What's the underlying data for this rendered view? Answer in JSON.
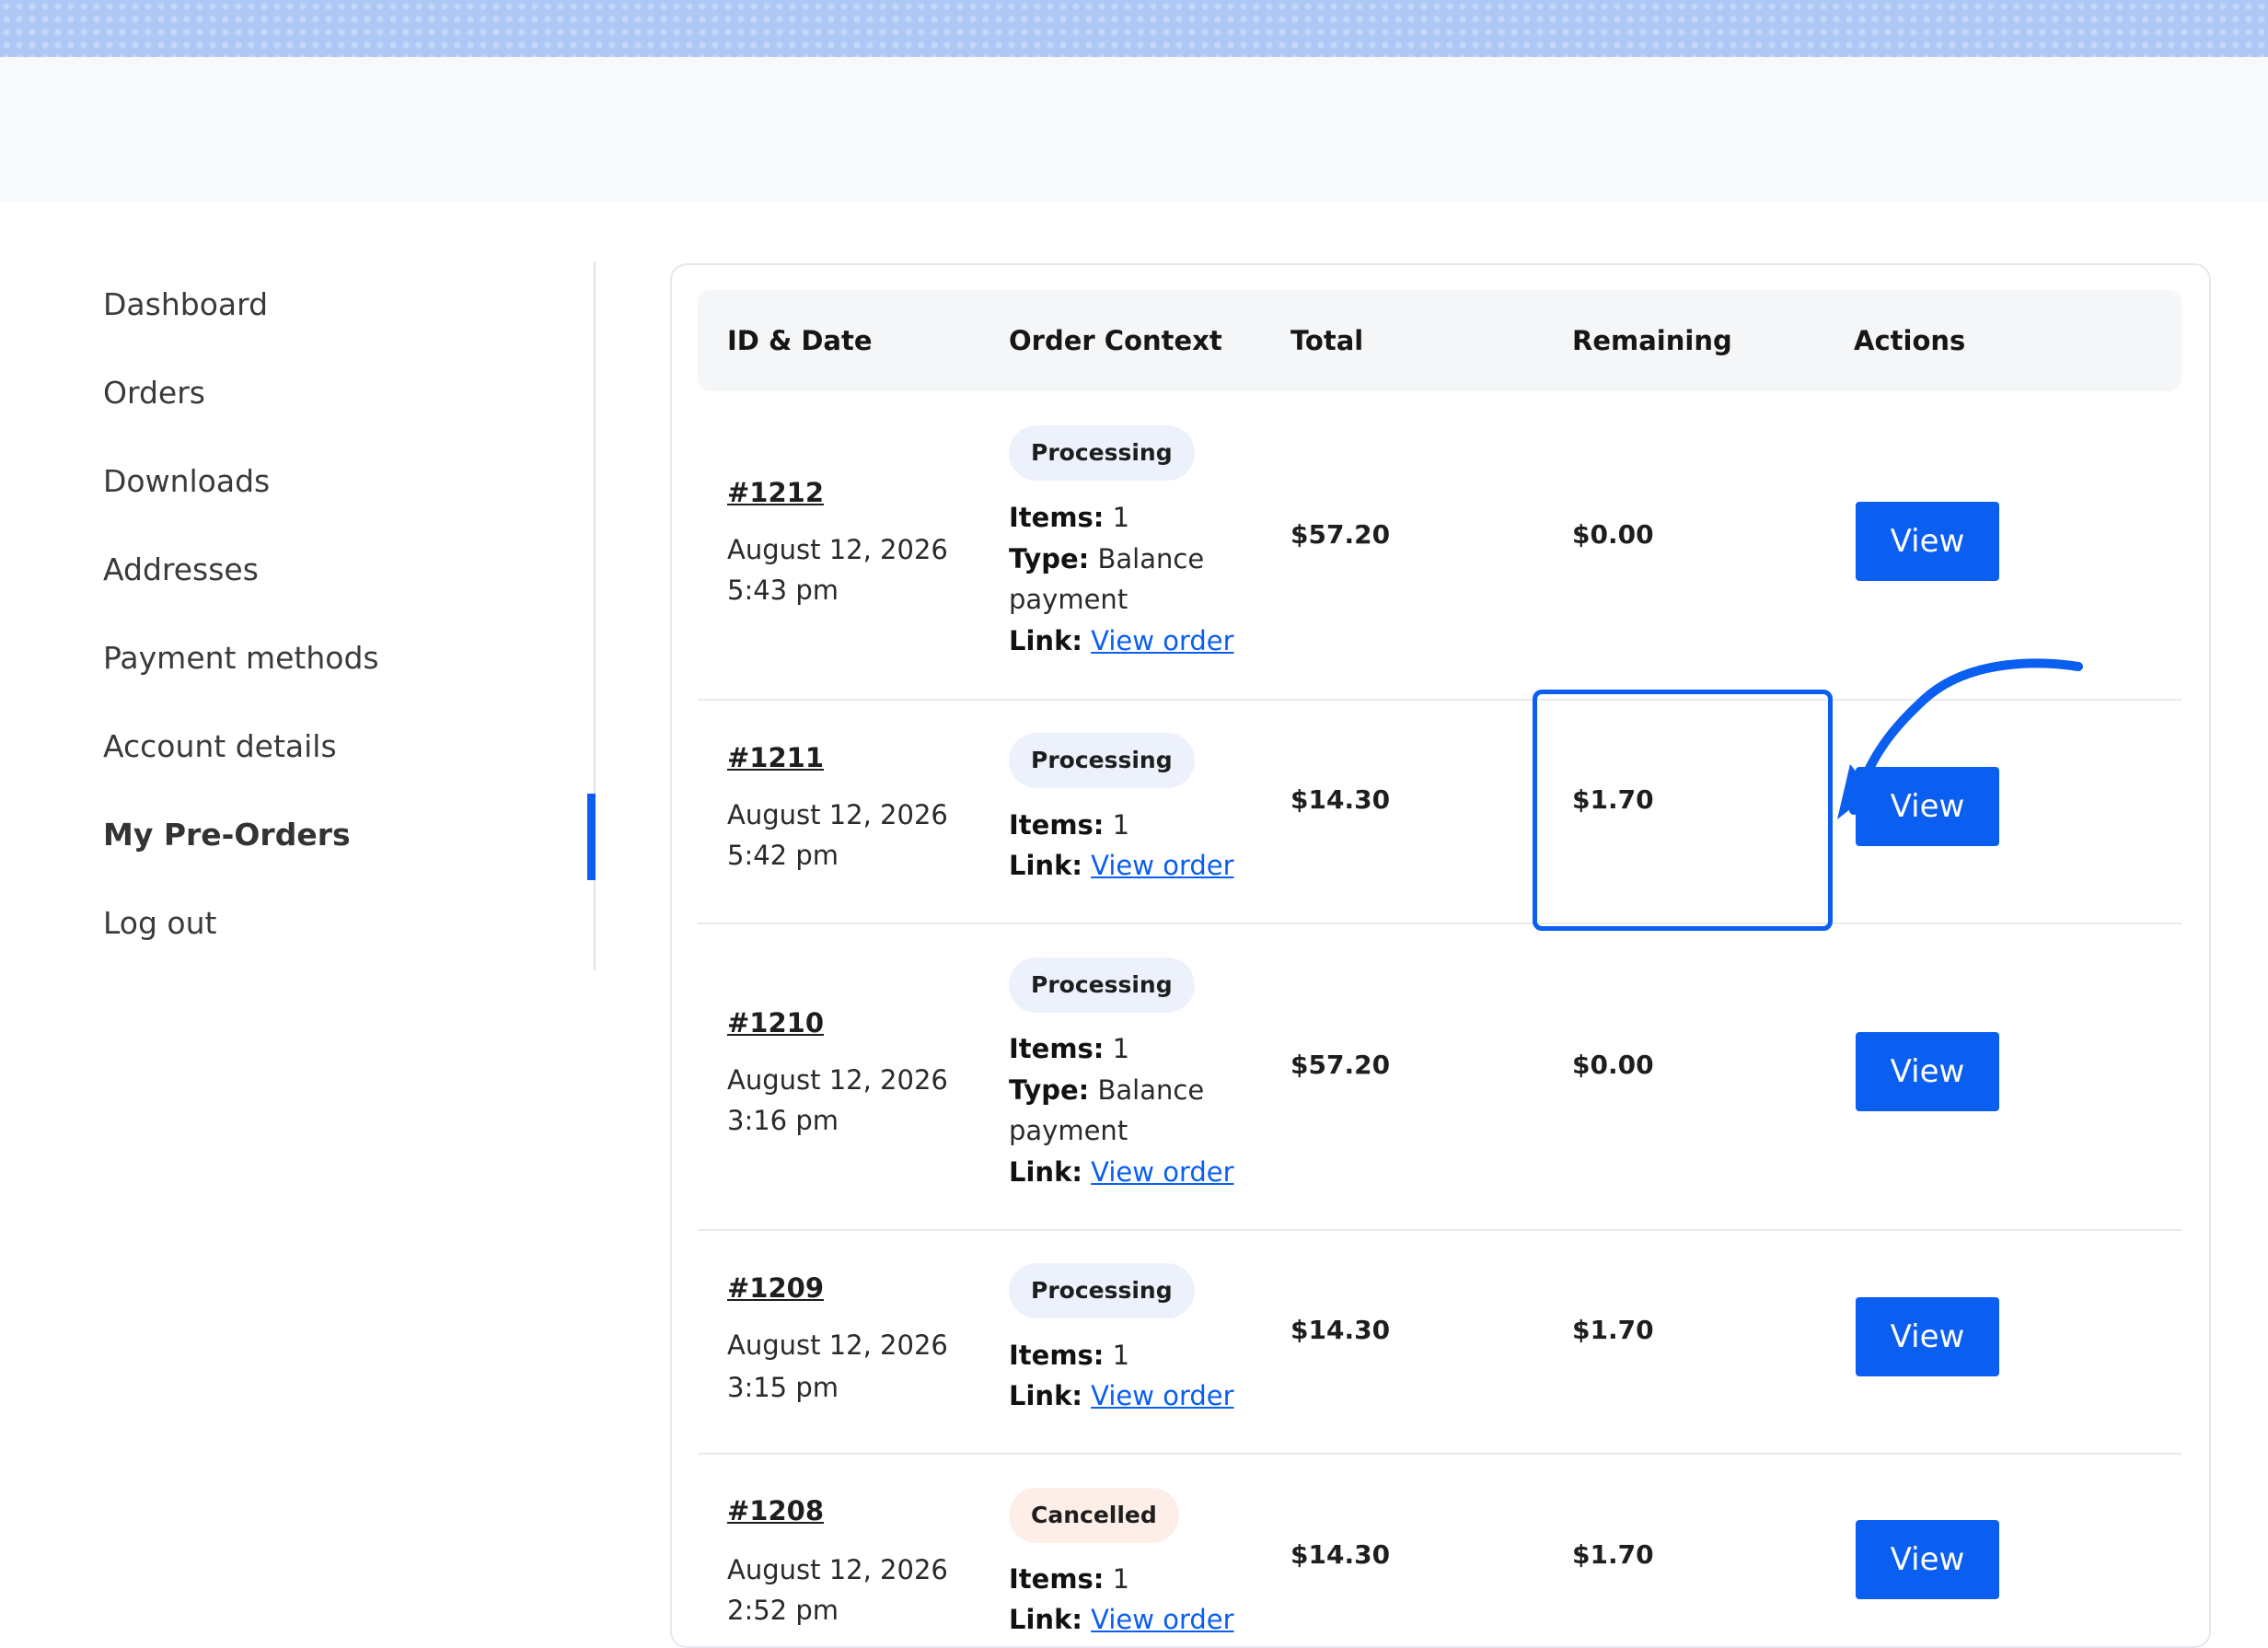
{
  "colors": {
    "accent": "#0a5ef0",
    "banner": "#aec8f6",
    "processing_badge": "#edf1fc",
    "cancelled_badge": "#fdeee8"
  },
  "sidebar": {
    "items": [
      {
        "label": "Dashboard"
      },
      {
        "label": "Orders"
      },
      {
        "label": "Downloads"
      },
      {
        "label": "Addresses"
      },
      {
        "label": "Payment methods"
      },
      {
        "label": "Account details"
      },
      {
        "label": "My Pre-Orders",
        "active": true
      },
      {
        "label": "Log out"
      }
    ]
  },
  "table": {
    "headers": {
      "id_date": "ID & Date",
      "context": "Order Context",
      "total": "Total",
      "remaining": "Remaining",
      "actions": "Actions"
    },
    "labels": {
      "items": "Items:",
      "type": "Type:",
      "link": "Link:",
      "view_order": "View order",
      "view_button": "View"
    },
    "rows": [
      {
        "id": "#1212",
        "date": "August 12, 2026",
        "time": "5:43 pm",
        "status": "Processing",
        "items": "1",
        "type_line1": "Balance",
        "type_line2": "payment",
        "total": "$57.20",
        "remaining": "$0.00"
      },
      {
        "id": "#1211",
        "date": "August 12, 2026",
        "time": "5:42 pm",
        "status": "Processing",
        "items": "1",
        "total": "$14.30",
        "remaining": "$1.70"
      },
      {
        "id": "#1210",
        "date": "August 12, 2026",
        "time": "3:16 pm",
        "status": "Processing",
        "items": "1",
        "type_line1": "Balance",
        "type_line2": "payment",
        "total": "$57.20",
        "remaining": "$0.00"
      },
      {
        "id": "#1209",
        "date": "August 12, 2026",
        "time": "3:15 pm",
        "status": "Processing",
        "items": "1",
        "total": "$14.30",
        "remaining": "$1.70"
      },
      {
        "id": "#1208",
        "date": "August 12, 2026",
        "time": "2:52 pm",
        "status": "Cancelled",
        "items": "1",
        "total": "$14.30",
        "remaining": "$1.70"
      }
    ]
  },
  "annotation": {
    "highlighted_cell": "row 2 remaining",
    "icon": "curved-arrow-icon"
  }
}
